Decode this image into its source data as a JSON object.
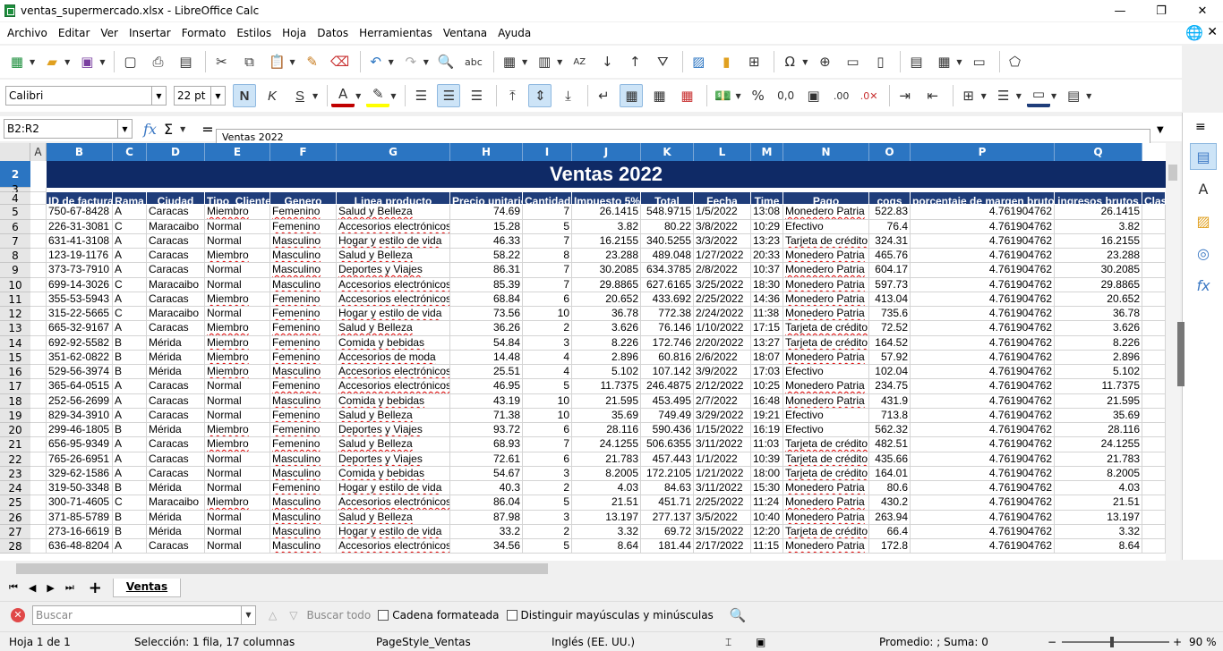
{
  "window": {
    "title": "ventas_supermercado.xlsx - LibreOffice Calc",
    "minimize": "—",
    "restore": "❐",
    "close": "✕"
  },
  "menu": [
    "Archivo",
    "Editar",
    "Ver",
    "Insertar",
    "Formato",
    "Estilos",
    "Hoja",
    "Datos",
    "Herramientas",
    "Ventana",
    "Ayuda"
  ],
  "toolbar": {
    "font_name": "Calibri",
    "font_size": "22 pt",
    "bold": "N",
    "italic": "K",
    "strike": "S",
    "percent": "%",
    "decimal": "0,0"
  },
  "formula": {
    "namebox": "B2:R2",
    "fx": "fx",
    "sigma": "Σ",
    "eq": "=",
    "content": "Ventas 2022"
  },
  "sheet": {
    "title": "Ventas 2022",
    "columns": [
      "A",
      "B",
      "C",
      "D",
      "E",
      "F",
      "G",
      "H",
      "I",
      "J",
      "K",
      "L",
      "M",
      "N",
      "O",
      "P",
      "Q"
    ],
    "row_numbers": [
      "2",
      "3",
      "4",
      "5",
      "6",
      "7",
      "8",
      "9",
      "10",
      "11",
      "12",
      "13",
      "14",
      "15",
      "16",
      "17",
      "18",
      "19",
      "20",
      "21",
      "22",
      "23",
      "24",
      "25",
      "26",
      "27",
      "28"
    ],
    "headers": [
      "ID de factura",
      "Rama",
      "Ciudad",
      "Tipo_Cliente",
      "Genero",
      "Linea producto",
      "Precio unitario",
      "Cantidad",
      "Impuesto 5%",
      "Total",
      "Fecha",
      "Time",
      "Pago",
      "cogs",
      "porcentaje de margen bruto",
      "ingresos brutos",
      "Clas"
    ],
    "rows": [
      [
        "750-67-8428",
        "A",
        "Caracas",
        "Miembro",
        "Femenino",
        "Salud y Belleza",
        "74.69",
        "7",
        "26.1415",
        "548.9715",
        "1/5/2022",
        "13:08",
        "Monedero Patria",
        "522.83",
        "4.761904762",
        "26.1415"
      ],
      [
        "226-31-3081",
        "C",
        "Maracaibo",
        "Normal",
        "Femenino",
        "Accesorios electrónicos",
        "15.28",
        "5",
        "3.82",
        "80.22",
        "3/8/2022",
        "10:29",
        "Efectivo",
        "76.4",
        "4.761904762",
        "3.82"
      ],
      [
        "631-41-3108",
        "A",
        "Caracas",
        "Normal",
        "Masculino",
        "Hogar y estilo de vida",
        "46.33",
        "7",
        "16.2155",
        "340.5255",
        "3/3/2022",
        "13:23",
        "Tarjeta de crédito",
        "324.31",
        "4.761904762",
        "16.2155"
      ],
      [
        "123-19-1176",
        "A",
        "Caracas",
        "Miembro",
        "Masculino",
        "Salud y Belleza",
        "58.22",
        "8",
        "23.288",
        "489.048",
        "1/27/2022",
        "20:33",
        "Monedero Patria",
        "465.76",
        "4.761904762",
        "23.288"
      ],
      [
        "373-73-7910",
        "A",
        "Caracas",
        "Normal",
        "Masculino",
        "Deportes y Viajes",
        "86.31",
        "7",
        "30.2085",
        "634.3785",
        "2/8/2022",
        "10:37",
        "Monedero Patria",
        "604.17",
        "4.761904762",
        "30.2085"
      ],
      [
        "699-14-3026",
        "C",
        "Maracaibo",
        "Normal",
        "Masculino",
        "Accesorios electrónicos",
        "85.39",
        "7",
        "29.8865",
        "627.6165",
        "3/25/2022",
        "18:30",
        "Monedero Patria",
        "597.73",
        "4.761904762",
        "29.8865"
      ],
      [
        "355-53-5943",
        "A",
        "Caracas",
        "Miembro",
        "Femenino",
        "Accesorios electrónicos",
        "68.84",
        "6",
        "20.652",
        "433.692",
        "2/25/2022",
        "14:36",
        "Monedero Patria",
        "413.04",
        "4.761904762",
        "20.652"
      ],
      [
        "315-22-5665",
        "C",
        "Maracaibo",
        "Normal",
        "Femenino",
        "Hogar y estilo de vida",
        "73.56",
        "10",
        "36.78",
        "772.38",
        "2/24/2022",
        "11:38",
        "Monedero Patria",
        "735.6",
        "4.761904762",
        "36.78"
      ],
      [
        "665-32-9167",
        "A",
        "Caracas",
        "Miembro",
        "Femenino",
        "Salud y Belleza",
        "36.26",
        "2",
        "3.626",
        "76.146",
        "1/10/2022",
        "17:15",
        "Tarjeta de crédito",
        "72.52",
        "4.761904762",
        "3.626"
      ],
      [
        "692-92-5582",
        "B",
        "Mérida",
        "Miembro",
        "Femenino",
        "Comida y bebidas",
        "54.84",
        "3",
        "8.226",
        "172.746",
        "2/20/2022",
        "13:27",
        "Tarjeta de crédito",
        "164.52",
        "4.761904762",
        "8.226"
      ],
      [
        "351-62-0822",
        "B",
        "Mérida",
        "Miembro",
        "Femenino",
        "Accesorios de moda",
        "14.48",
        "4",
        "2.896",
        "60.816",
        "2/6/2022",
        "18:07",
        "Monedero Patria",
        "57.92",
        "4.761904762",
        "2.896"
      ],
      [
        "529-56-3974",
        "B",
        "Mérida",
        "Miembro",
        "Masculino",
        "Accesorios electrónicos",
        "25.51",
        "4",
        "5.102",
        "107.142",
        "3/9/2022",
        "17:03",
        "Efectivo",
        "102.04",
        "4.761904762",
        "5.102"
      ],
      [
        "365-64-0515",
        "A",
        "Caracas",
        "Normal",
        "Femenino",
        "Accesorios electrónicos",
        "46.95",
        "5",
        "11.7375",
        "246.4875",
        "2/12/2022",
        "10:25",
        "Monedero Patria",
        "234.75",
        "4.761904762",
        "11.7375"
      ],
      [
        "252-56-2699",
        "A",
        "Caracas",
        "Normal",
        "Masculino",
        "Comida y bebidas",
        "43.19",
        "10",
        "21.595",
        "453.495",
        "2/7/2022",
        "16:48",
        "Monedero Patria",
        "431.9",
        "4.761904762",
        "21.595"
      ],
      [
        "829-34-3910",
        "A",
        "Caracas",
        "Normal",
        "Femenino",
        "Salud y Belleza",
        "71.38",
        "10",
        "35.69",
        "749.49",
        "3/29/2022",
        "19:21",
        "Efectivo",
        "713.8",
        "4.761904762",
        "35.69"
      ],
      [
        "299-46-1805",
        "B",
        "Mérida",
        "Miembro",
        "Femenino",
        "Deportes y Viajes",
        "93.72",
        "6",
        "28.116",
        "590.436",
        "1/15/2022",
        "16:19",
        "Efectivo",
        "562.32",
        "4.761904762",
        "28.116"
      ],
      [
        "656-95-9349",
        "A",
        "Caracas",
        "Miembro",
        "Femenino",
        "Salud y Belleza",
        "68.93",
        "7",
        "24.1255",
        "506.6355",
        "3/11/2022",
        "11:03",
        "Tarjeta de crédito",
        "482.51",
        "4.761904762",
        "24.1255"
      ],
      [
        "765-26-6951",
        "A",
        "Caracas",
        "Normal",
        "Masculino",
        "Deportes y Viajes",
        "72.61",
        "6",
        "21.783",
        "457.443",
        "1/1/2022",
        "10:39",
        "Tarjeta de crédito",
        "435.66",
        "4.761904762",
        "21.783"
      ],
      [
        "329-62-1586",
        "A",
        "Caracas",
        "Normal",
        "Masculino",
        "Comida y bebidas",
        "54.67",
        "3",
        "8.2005",
        "172.2105",
        "1/21/2022",
        "18:00",
        "Tarjeta de crédito",
        "164.01",
        "4.761904762",
        "8.2005"
      ],
      [
        "319-50-3348",
        "B",
        "Mérida",
        "Normal",
        "Femenino",
        "Hogar y estilo de vida",
        "40.3",
        "2",
        "4.03",
        "84.63",
        "3/11/2022",
        "15:30",
        "Monedero Patria",
        "80.6",
        "4.761904762",
        "4.03"
      ],
      [
        "300-71-4605",
        "C",
        "Maracaibo",
        "Miembro",
        "Masculino",
        "Accesorios electrónicos",
        "86.04",
        "5",
        "21.51",
        "451.71",
        "2/25/2022",
        "11:24",
        "Monedero Patria",
        "430.2",
        "4.761904762",
        "21.51"
      ],
      [
        "371-85-5789",
        "B",
        "Mérida",
        "Normal",
        "Masculino",
        "Salud y Belleza",
        "87.98",
        "3",
        "13.197",
        "277.137",
        "3/5/2022",
        "10:40",
        "Monedero Patria",
        "263.94",
        "4.761904762",
        "13.197"
      ],
      [
        "273-16-6619",
        "B",
        "Mérida",
        "Normal",
        "Masculino",
        "Hogar y estilo de vida",
        "33.2",
        "2",
        "3.32",
        "69.72",
        "3/15/2022",
        "12:20",
        "Tarjeta de crédito",
        "66.4",
        "4.761904762",
        "3.32"
      ],
      [
        "636-48-8204",
        "A",
        "Caracas",
        "Normal",
        "Masculino",
        "Accesorios electrónicos",
        "34.56",
        "5",
        "8.64",
        "181.44",
        "2/17/2022",
        "11:15",
        "Monedero Patria",
        "172.8",
        "4.761904762",
        "8.64"
      ]
    ]
  },
  "tabs": {
    "sheet": "Ventas",
    "add": "+"
  },
  "findbar": {
    "placeholder": "Buscar",
    "find_all": "Buscar todo",
    "formatted": "Cadena formateada",
    "match_case": "Distinguir mayúsculas y minúsculas"
  },
  "status": {
    "sheet": "Hoja 1 de 1",
    "selection": "Selección: 1 fila, 17 columnas",
    "pagestyle": "PageStyle_Ventas",
    "language": "Inglés (EE. UU.)",
    "sum": "Promedio: ; Suma: 0",
    "zoom": "90 %"
  }
}
